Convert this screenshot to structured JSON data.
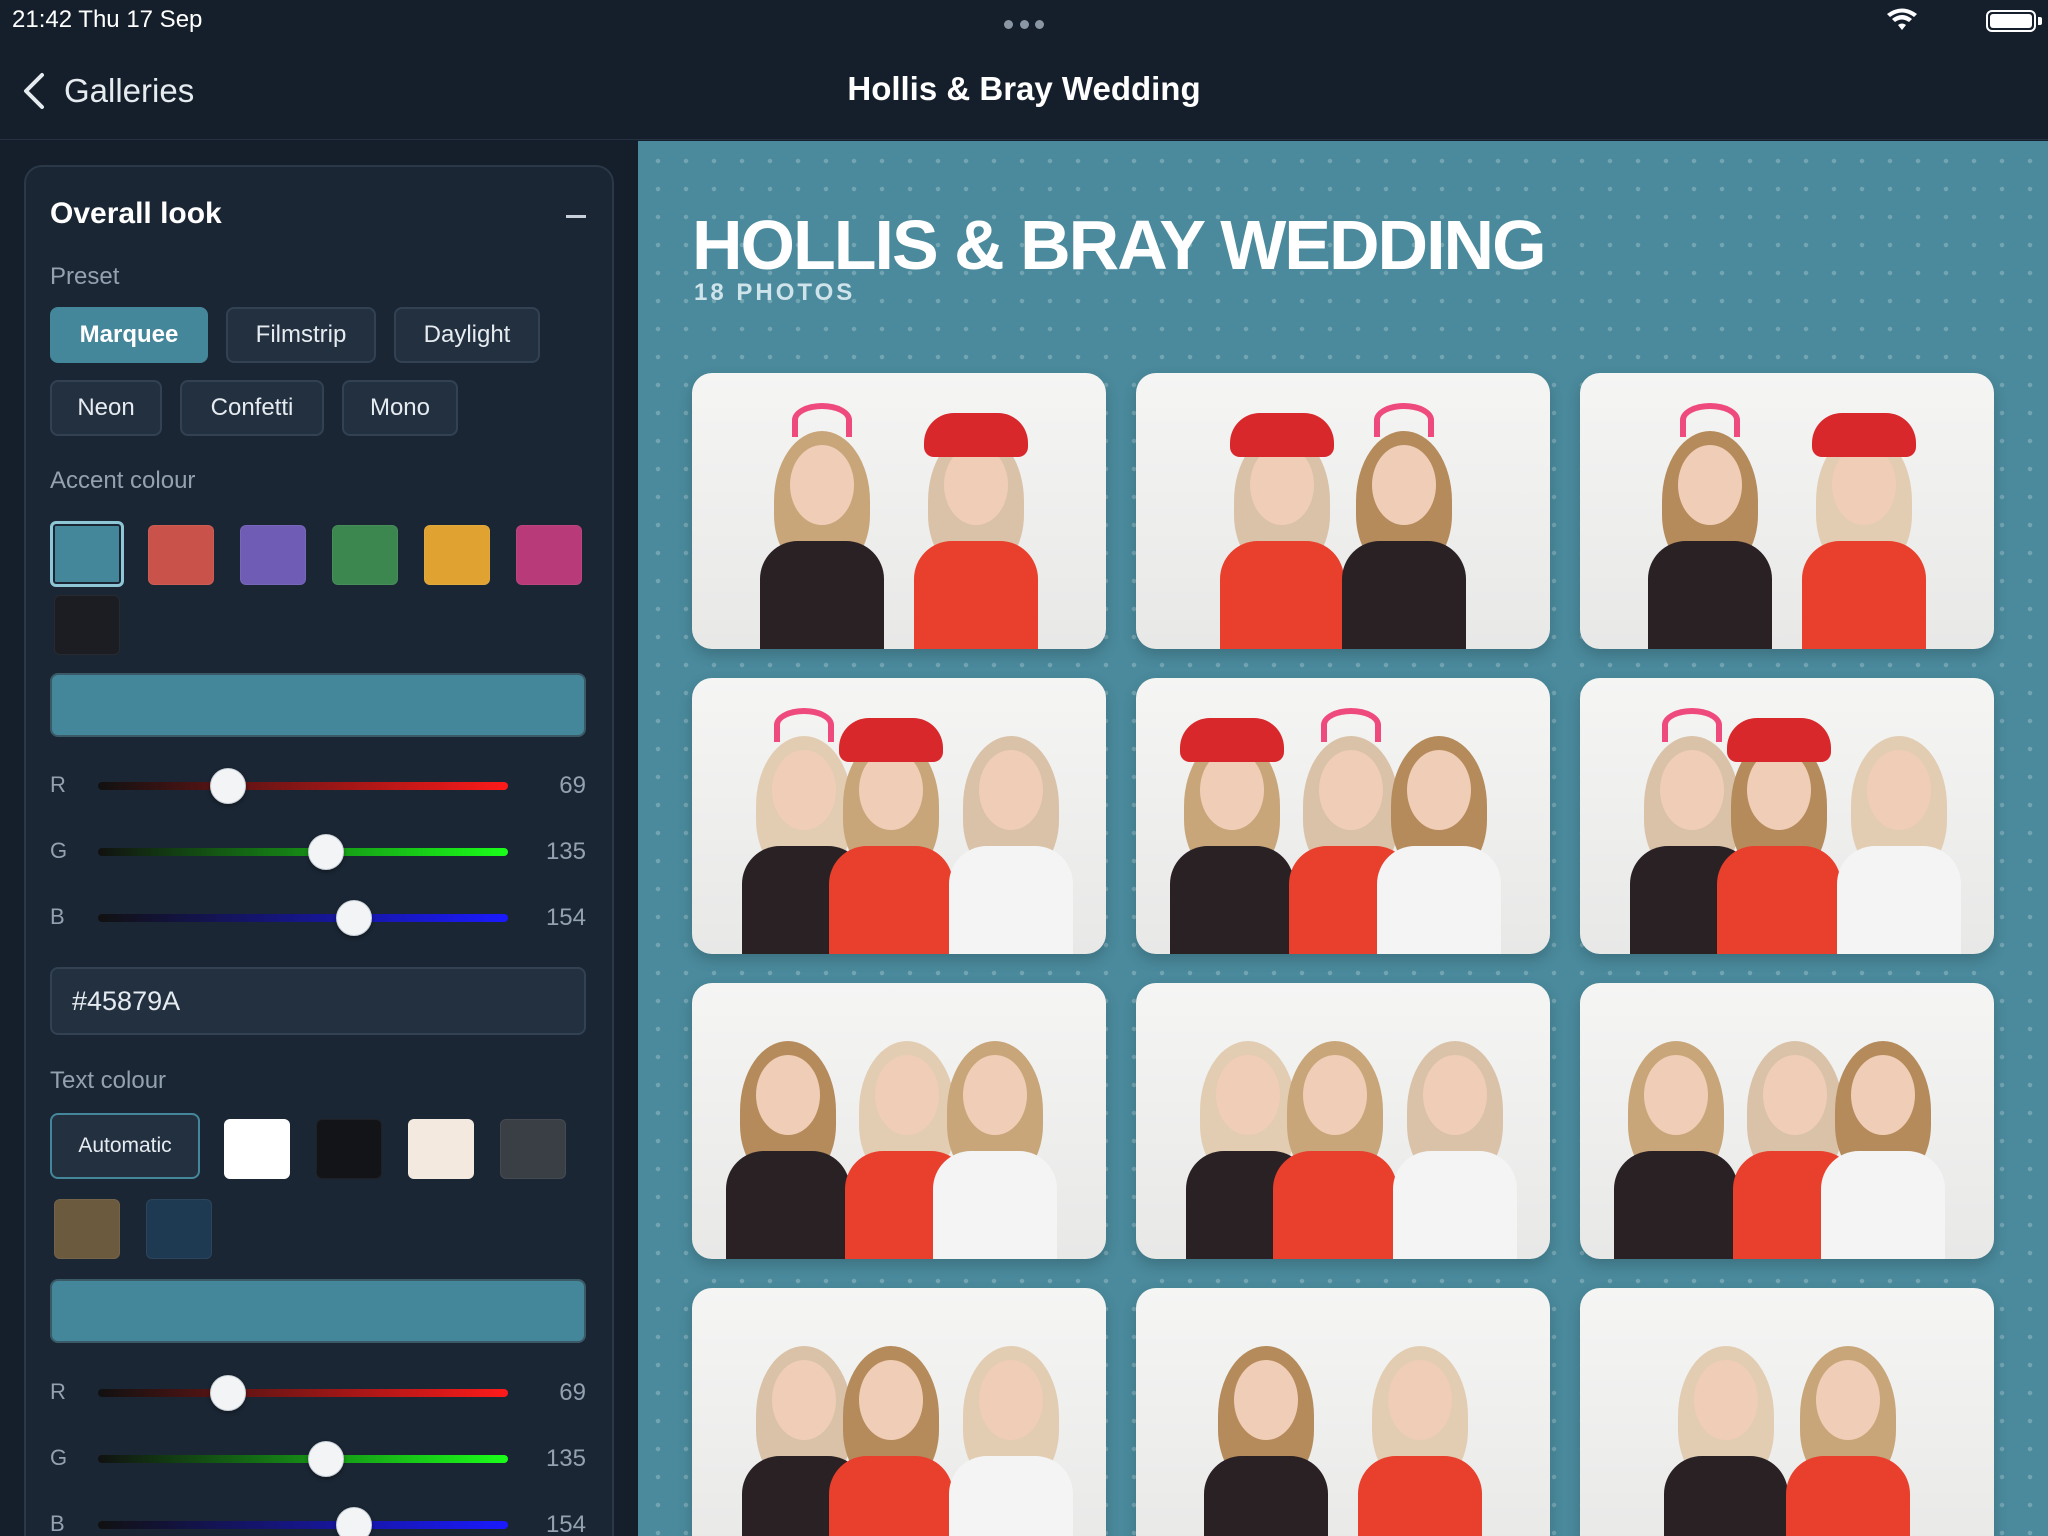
{
  "status_bar": {
    "time": "21:42  Thu 17 Sep"
  },
  "nav": {
    "back_label": "Galleries",
    "title": "Hollis & Bray Wedding"
  },
  "panel": {
    "title": "Overall look",
    "preset_label": "Preset",
    "presets": [
      "Marquee",
      "Filmstrip",
      "Daylight",
      "Neon",
      "Confetti",
      "Mono"
    ],
    "selected_preset": "Marquee",
    "accent_label": "Accent colour",
    "accent_swatches": [
      "#45879A",
      "#c9534b",
      "#6f5db5",
      "#3c8650",
      "#e0a332",
      "#b83a78",
      "#1b1d22"
    ],
    "accent": {
      "r_label": "R",
      "g_label": "G",
      "b_label": "B",
      "r": "69",
      "g": "135",
      "b": "154",
      "hex": "#45879A"
    },
    "text_label": "Text colour",
    "text_auto_label": "Automatic",
    "text_swatches": [
      "#ffffff",
      "#121417",
      "#f3e9df",
      "#3a3f46",
      "#6b5a3e",
      "#1e3a52"
    ],
    "text": {
      "r_label": "R",
      "g_label": "G",
      "b_label": "B",
      "r": "69",
      "g": "135",
      "b": "154"
    }
  },
  "gallery": {
    "title": "HOLLIS & BRAY WEDDING",
    "count": "18 PHOTOS",
    "photos": [
      "photo-1",
      "photo-2",
      "photo-3",
      "photo-4",
      "photo-5",
      "photo-6",
      "photo-7",
      "photo-8",
      "photo-9",
      "photo-10",
      "photo-11",
      "photo-12"
    ]
  },
  "colors": {
    "accent": "#45879A",
    "background": "#151f2b",
    "panel": "#1a2634",
    "gallery_bg": "#4a8a9c"
  }
}
